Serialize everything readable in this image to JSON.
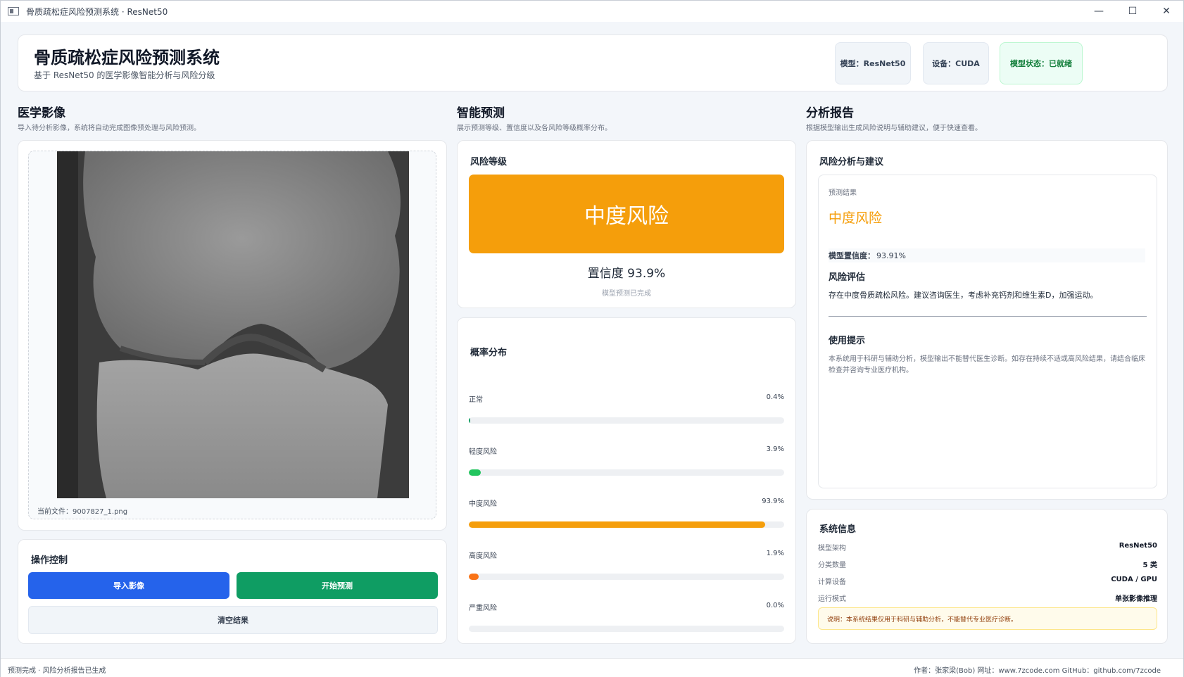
{
  "window": {
    "title": "骨质疏松症风险预测系统 · ResNet50",
    "minimize": "—",
    "maximize": "☐",
    "close": "✕"
  },
  "header": {
    "title": "骨质疏松症风险预测系统",
    "subtitle": "基于 ResNet50 的医学影像智能分析与风险分级",
    "badges": {
      "model": "模型：ResNet50",
      "device": "设备：CUDA",
      "status": "模型状态：已就绪"
    },
    "colors": {
      "status_ok": "#15803d"
    }
  },
  "sections": {
    "image": {
      "title": "医学影像",
      "subtitle": "导入待分析影像，系统将自动完成图像预处理与风险预测。"
    },
    "predict": {
      "title": "智能预测",
      "subtitle": "展示预测等级、置信度以及各风险等级概率分布。"
    },
    "report": {
      "title": "分析报告",
      "subtitle": "根据模型输出生成风险说明与辅助建议，便于快速查看。"
    }
  },
  "image_panel": {
    "current_file": "当前文件：9007827_1.png"
  },
  "controls": {
    "title": "操作控制",
    "import_label": "导入影像",
    "predict_label": "开始预测",
    "clear_label": "清空结果"
  },
  "risk_level": {
    "title": "风险等级",
    "value": "中度风险",
    "confidence": "置信度  93.9%",
    "note": "模型预测已完成",
    "color": "#f59e0b"
  },
  "probability": {
    "title": "概率分布",
    "rows": [
      {
        "label": "正常",
        "value": "0.4%",
        "fraction": 0.004,
        "color": "#0f9d63"
      },
      {
        "label": "轻度风险",
        "value": "3.9%",
        "fraction": 0.039,
        "color": "#22c55e"
      },
      {
        "label": "中度风险",
        "value": "93.9%",
        "fraction": 0.939,
        "color": "#f59e0b"
      },
      {
        "label": "高度风险",
        "value": "1.9%",
        "fraction": 0.019,
        "color": "#f97316"
      },
      {
        "label": "严重风险",
        "value": "0.0%",
        "fraction": 0.0,
        "color": "#dc2626"
      }
    ]
  },
  "report": {
    "title": "风险分析与建议",
    "result_label": "预测结果",
    "result_value": "中度风险",
    "confidence_key": "模型置信度：",
    "confidence_value": "93.91%",
    "assessment_title": "风险评估",
    "assessment_text": "存在中度骨质疏松风险。建议咨询医生，考虑补充钙剂和维生素D，加强运动。",
    "tips_title": "使用提示",
    "tips_text": "本系统用于科研与辅助分析，模型输出不能替代医生诊断。如存在持续不适或高风险结果，请结合临床检查并咨询专业医疗机构。"
  },
  "system_info": {
    "title": "系统信息",
    "rows": [
      {
        "key": "模型架构",
        "value": "ResNet50"
      },
      {
        "key": "分类数量",
        "value": "5 类"
      },
      {
        "key": "计算设备",
        "value": "CUDA / GPU"
      },
      {
        "key": "运行模式",
        "value": "单张影像推理"
      }
    ],
    "notice": "说明：本系统结果仅用于科研与辅助分析，不能替代专业医疗诊断。"
  },
  "statusbar": {
    "left": "预测完成 · 风险分析报告已生成",
    "right": "作者：张家梁(Bob)  网址：www.7zcode.com GitHub：github.com/7zcode"
  }
}
